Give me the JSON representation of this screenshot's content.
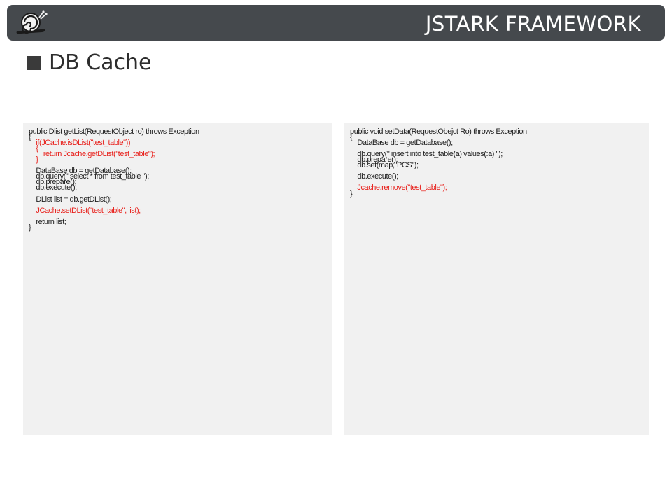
{
  "header": {
    "title": "JSTARK FRAMEWORK",
    "logo_icon": "snail-logo-icon"
  },
  "page": {
    "title": "DB Cache"
  },
  "colors": {
    "header_bg": "#45494d",
    "panel_bg": "#f1f1f1",
    "highlight": "#e8211c"
  },
  "left_code": [
    {
      "text": "public Dlist getList(RequestObject ro) throws Exception",
      "hl": false
    },
    {
      "text": "{",
      "hl": false
    },
    {
      "text": "    if(JCache.isDList(\"test_table\"))",
      "hl": true
    },
    {
      "text": "    {",
      "hl": true
    },
    {
      "text": "        return Jcache.getDList(\"test_table\");",
      "hl": true
    },
    {
      "text": "    }",
      "hl": true
    },
    {
      "text": "",
      "hl": false
    },
    {
      "text": "    DataBase db = getDatabase();",
      "hl": false
    },
    {
      "text": "    db.query(\" select * from test_table \");",
      "hl": false
    },
    {
      "text": "    db.prepare();",
      "hl": false
    },
    {
      "text": "    db.execute();",
      "hl": false
    },
    {
      "text": "",
      "hl": false
    },
    {
      "text": "    DList list = db.getDList();",
      "hl": false
    },
    {
      "text": "",
      "hl": false
    },
    {
      "text": "    JCache.setDList(\"test_table\", list);",
      "hl": true
    },
    {
      "text": "",
      "hl": false
    },
    {
      "text": "    return list;",
      "hl": false
    },
    {
      "text": "}",
      "hl": false
    }
  ],
  "right_code": [
    {
      "text": "public void setData(RequestObejct Ro) throws Exception",
      "hl": false
    },
    {
      "text": "{",
      "hl": false
    },
    {
      "text": "    DataBase db = getDatabase();",
      "hl": false
    },
    {
      "text": "",
      "hl": false
    },
    {
      "text": "    db.query(\" insert into test_table(a) values(:a) \");",
      "hl": false
    },
    {
      "text": "    db.prepare();",
      "hl": false
    },
    {
      "text": "    db.set(map,\"PCS\");",
      "hl": false
    },
    {
      "text": "",
      "hl": false
    },
    {
      "text": "    db.execute();",
      "hl": false
    },
    {
      "text": "",
      "hl": false
    },
    {
      "text": "    Jcache.remove(\"test_table\");",
      "hl": true
    },
    {
      "text": "}",
      "hl": false
    }
  ]
}
